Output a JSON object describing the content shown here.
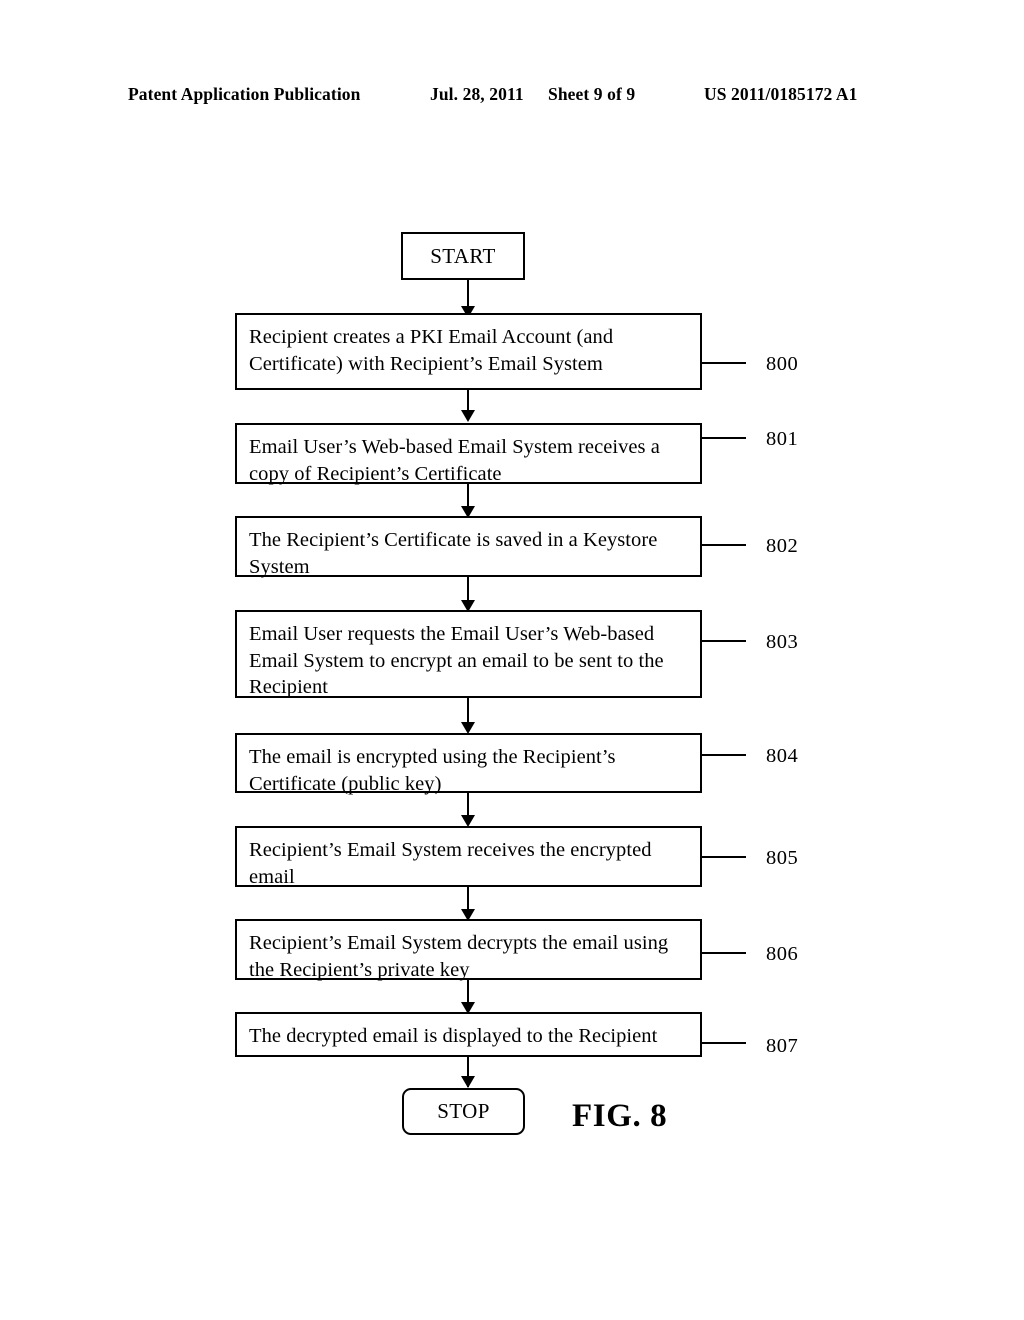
{
  "header": {
    "publication": "Patent Application Publication",
    "date": "Jul. 28, 2011",
    "sheet": "Sheet 9 of 9",
    "doc_number": "US 2011/0185172 A1"
  },
  "figure": {
    "caption": "FIG. 8",
    "start_label": "START",
    "stop_label": "STOP",
    "steps": [
      {
        "ref": "800",
        "text": "Recipient creates a PKI Email Account (and\nCertificate) with Recipient’s Email System"
      },
      {
        "ref": "801",
        "text": "Email User’s Web-based Email System receives a\ncopy of Recipient’s Certificate"
      },
      {
        "ref": "802",
        "text": "The Recipient’s Certificate is saved in a Keystore\nSystem"
      },
      {
        "ref": "803",
        "text": "Email User requests the Email User’s Web-based\nEmail System to encrypt an email to be sent to the\nRecipient"
      },
      {
        "ref": "804",
        "text": "The email is encrypted using the Recipient’s\nCertificate (public key)"
      },
      {
        "ref": "805",
        "text": "Recipient’s Email System receives the encrypted\nemail"
      },
      {
        "ref": "806",
        "text": "Recipient’s Email System decrypts the email using\nthe Recipient’s private key"
      },
      {
        "ref": "807",
        "text": "The decrypted email is displayed to the Recipient"
      }
    ]
  },
  "colors": {
    "ink": "#000000",
    "paper": "#ffffff"
  }
}
